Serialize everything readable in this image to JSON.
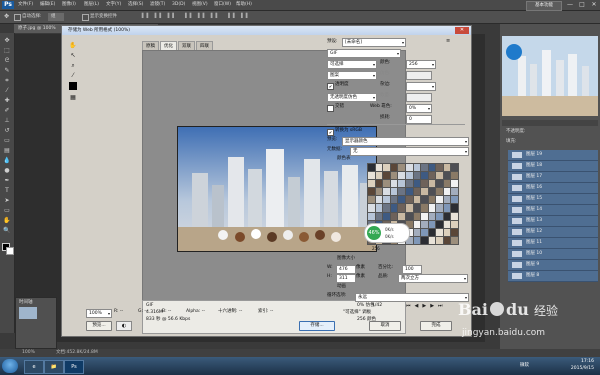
{
  "menubar": {
    "logo": "Ps",
    "menus": [
      "文件(F)",
      "编辑(E)",
      "图像(I)",
      "图层(L)",
      "文字(Y)",
      "选择(S)",
      "滤镜(T)",
      "3D(D)",
      "视图(V)",
      "窗口(W)",
      "帮助(H)"
    ],
    "workspace": "基本功能",
    "window_controls": [
      "—",
      "□",
      "✕"
    ]
  },
  "options_bar": {
    "auto_select_label": "自动选择:",
    "auto_select_value": "组",
    "show_transform": "显示变换控件"
  },
  "document_tab": "原子.jpg @ 100%",
  "status_bar": {
    "zoom": "100%",
    "doc_info": "文档:452.8K/24.8M"
  },
  "timeline_label": "时间轴",
  "taskbar": {
    "apps": [
      "e",
      "📁",
      "Ps"
    ],
    "ime": "微软",
    "time": "17:16",
    "date": "2015/9/15"
  },
  "layers_panel": {
    "rows": [
      "图层 19",
      "图层 18",
      "图层 17",
      "图层 16",
      "图层 15",
      "图层 14",
      "图层 13",
      "图层 12",
      "图层 11",
      "图层 10",
      "图层 9",
      "图层 8"
    ],
    "opacity_label": "不透明度:",
    "fill_label": "填充:"
  },
  "dialog": {
    "title": "存储为 Web 所用格式 (100%)",
    "close": "✕",
    "tabs": [
      "原稿",
      "优化",
      "双联",
      "四联"
    ],
    "active_tab": 1,
    "preset_label": "预设:",
    "preset_value": "[未命名]",
    "format": "GIF",
    "reduction": "可选择",
    "dither_algo": "图案",
    "transparency_label": "透明度",
    "transparency_checked": true,
    "matte_algo": "无透明度仿色",
    "interlaced_label": "交错",
    "colors_label": "颜色:",
    "colors_value": "256",
    "dither_label": "仿色:",
    "matte_label": "杂边:",
    "amount_label": "数量:",
    "web_snap_label": "Web 靠色:",
    "web_snap_value": "0%",
    "lossy_label": "损耗:",
    "lossy_value": "0",
    "convert_srgb_label": "转换为 sRGB",
    "convert_srgb_checked": true,
    "preview_label": "预览:",
    "preview_value": "显示器颜色",
    "metadata_label": "元数据:",
    "metadata_value": "无",
    "color_table_label": "颜色表",
    "color_table_count": "256",
    "image_size_label": "图像大小",
    "width_label": "W:",
    "width_value": "476",
    "height_label": "H:",
    "height_value": "311",
    "unit": "像素",
    "percent_label": "百分比:",
    "percent_value": "100",
    "quality_label": "品质:",
    "quality_value": "两次立方",
    "animation_label": "动画",
    "loop_label": "循环选项:",
    "loop_value": "永远",
    "frame_counter": "1/42",
    "info": {
      "format": "GIF",
      "size": "4.316M",
      "time": "833 秒 @ 56.6 Kbps",
      "dither_pct": "0% 仿色",
      "palette": "\"可选择\" 调板",
      "colors": "256 颜色"
    },
    "zoom_value": "100%",
    "readouts": [
      "R: --",
      "G: --",
      "B: --",
      "Alpha: --",
      "十六进制: --",
      "索引: --"
    ],
    "buttons": {
      "preview": "预览...",
      "save": "存储...",
      "cancel": "取消",
      "done": "完成"
    }
  },
  "toast": {
    "percent": "46%",
    "up": "0K/s",
    "down": "0K/s"
  },
  "watermark": {
    "line1": "Bai",
    "line2": "du",
    "line3": "经验",
    "url": "jingyan.baidu.com"
  },
  "colors": {
    "accent": "#1a5b9e",
    "layer_sel": "#4f6e92",
    "dialog_bg": "#d4d0c8"
  }
}
